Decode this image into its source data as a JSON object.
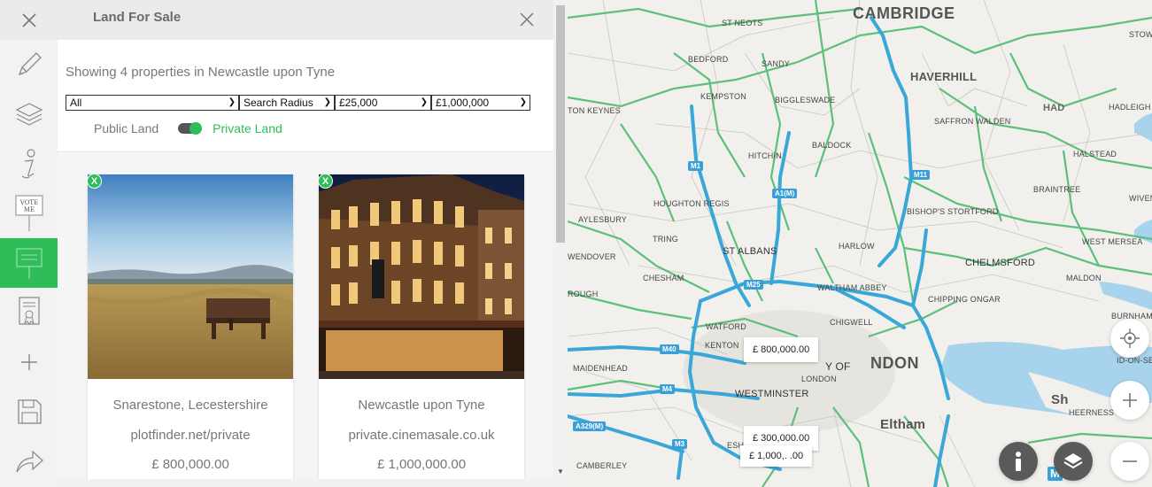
{
  "panel": {
    "title": "Land For Sale",
    "results_text": "Showing 4 properties in Newcastle upon Tyne"
  },
  "filters": {
    "type": "All",
    "radius": "Search Radius",
    "min_price": "£25,000",
    "max_price": "£1,000,000"
  },
  "land_toggle": {
    "public_label": "Public Land",
    "private_label": "Private Land",
    "selected": "Private Land"
  },
  "cards": [
    {
      "badge": "X",
      "location": "Snarestone, Lecestershire",
      "source": "plotfinder.net/private",
      "price": "£ 800,000.00"
    },
    {
      "badge": "X",
      "location": "Newcastle upon Tyne",
      "source": "private.cinemasale.co.uk",
      "price": "£ 1,000,000.00"
    }
  ],
  "toolbar_icons": [
    "close-icon",
    "pencil-icon",
    "layers-icon",
    "info-icon",
    "vote-icon",
    "land-sale-icon",
    "certificate-icon",
    "plus-icon",
    "save-icon",
    "share-icon"
  ],
  "vote_sign": {
    "line1": "VOTE",
    "line2": "ME"
  },
  "map": {
    "places": {
      "cambridge": "CAMBRIDGE",
      "haverhill": "HAVERHILL",
      "st_neots": "ST NEOTS",
      "bedford": "BEDFORD",
      "sandy": "SANDY",
      "kempston": "KEMPSTON",
      "biggleswade": "BIGGLESWADE",
      "saffron_walden": "SAFFRON WALDEN",
      "haverhill_edge": "HAD",
      "hadleigh": "HADLEIGH",
      "stow": "STOW",
      "milton_keynes": "TON KEYNES",
      "baldock": "BALDOCK",
      "halstead": "HALSTEAD",
      "hitchin": "HITCHIN",
      "braintree": "BRAINTREE",
      "wiven": "WIVEN",
      "houghton_regis": "HOUGHTON REGIS",
      "bishops_stortford": "BISHOP'S STORTFORD",
      "aylesbury": "AYLESBURY",
      "tring": "TRING",
      "west_mersea": "WEST MERSEA",
      "wendover": "WENDOVER",
      "st_albans": "ST ALBANS",
      "harlow": "HARLOW",
      "chelmsford": "CHELMSFORD",
      "chesham": "CHESHAM",
      "maldon": "MALDON",
      "rough": "ROUGH",
      "waltham_abbey": "WALTHAM ABBEY",
      "chipping_ongar": "CHIPPING ONGAR",
      "burnham": "BURNHAM",
      "chigwell": "CHIGWELL",
      "watford": "WATFORD",
      "kenton": "KENTON",
      "city_of": "Y OF",
      "london": "LONDON",
      "london_big": "NDON",
      "on_sea": "ID-ON-SEA",
      "maidenhead": "MAIDENHEAD",
      "westminster": "WESTMINSTER",
      "sh": "Sh",
      "sheerness": "HEERNESS",
      "eltham": "Eltham",
      "esh": "ESH",
      "camberley": "CAMBERLEY"
    },
    "roads": [
      "M1",
      "A1(M)",
      "M11",
      "M25",
      "M40",
      "M4",
      "A329(M)",
      "M3",
      "M"
    ],
    "markers": [
      {
        "label": "£ 800,000.00"
      },
      {
        "label": "£ 300,000.00"
      },
      {
        "label": "£ 1,000,.   .00"
      }
    ]
  }
}
